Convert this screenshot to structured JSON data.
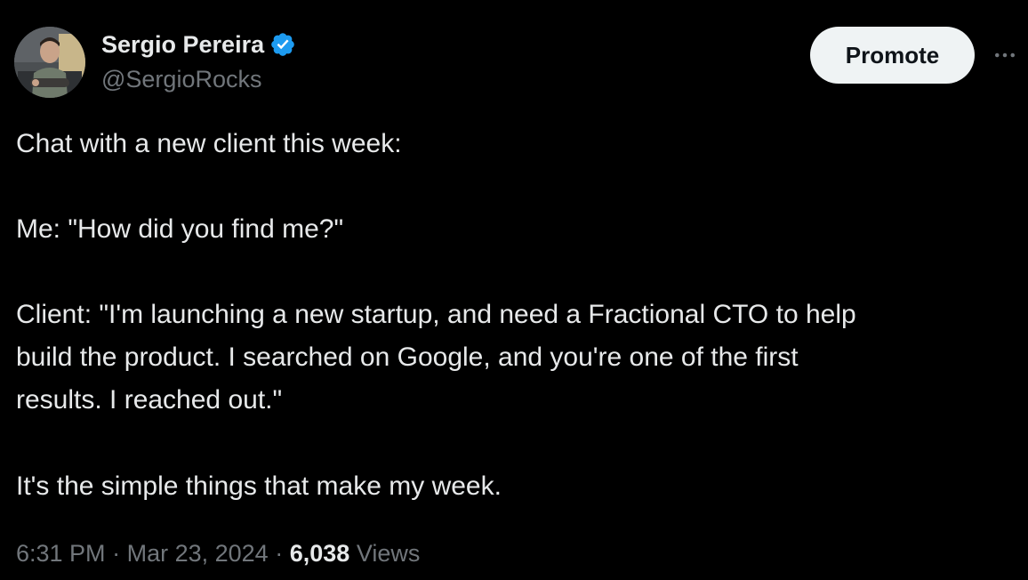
{
  "author": {
    "name": "Sergio Pereira",
    "handle": "@SergioRocks",
    "verified_color": "#1d9bf0"
  },
  "actions": {
    "promote_label": "Promote",
    "more_icon": "more-horizontal-icon"
  },
  "tweet": {
    "lines": [
      "Chat with a new client this week:",
      "Me: \"How did you find me?\"",
      "Client: \"I'm launching a new startup, and need a Fractional CTO to help",
      "build the product. I searched on Google, and you're one of the first",
      "results. I reached out.\"",
      "It's the simple things that make my week."
    ]
  },
  "meta": {
    "time": "6:31 PM",
    "separator": "·",
    "date": "Mar 23, 2024",
    "views_count": "6,038",
    "views_label": "Views"
  },
  "colors": {
    "background": "#000000",
    "text_primary": "#e7e9ea",
    "text_secondary": "#71767b",
    "button_bg": "#eff3f4",
    "button_text": "#0f1419"
  }
}
